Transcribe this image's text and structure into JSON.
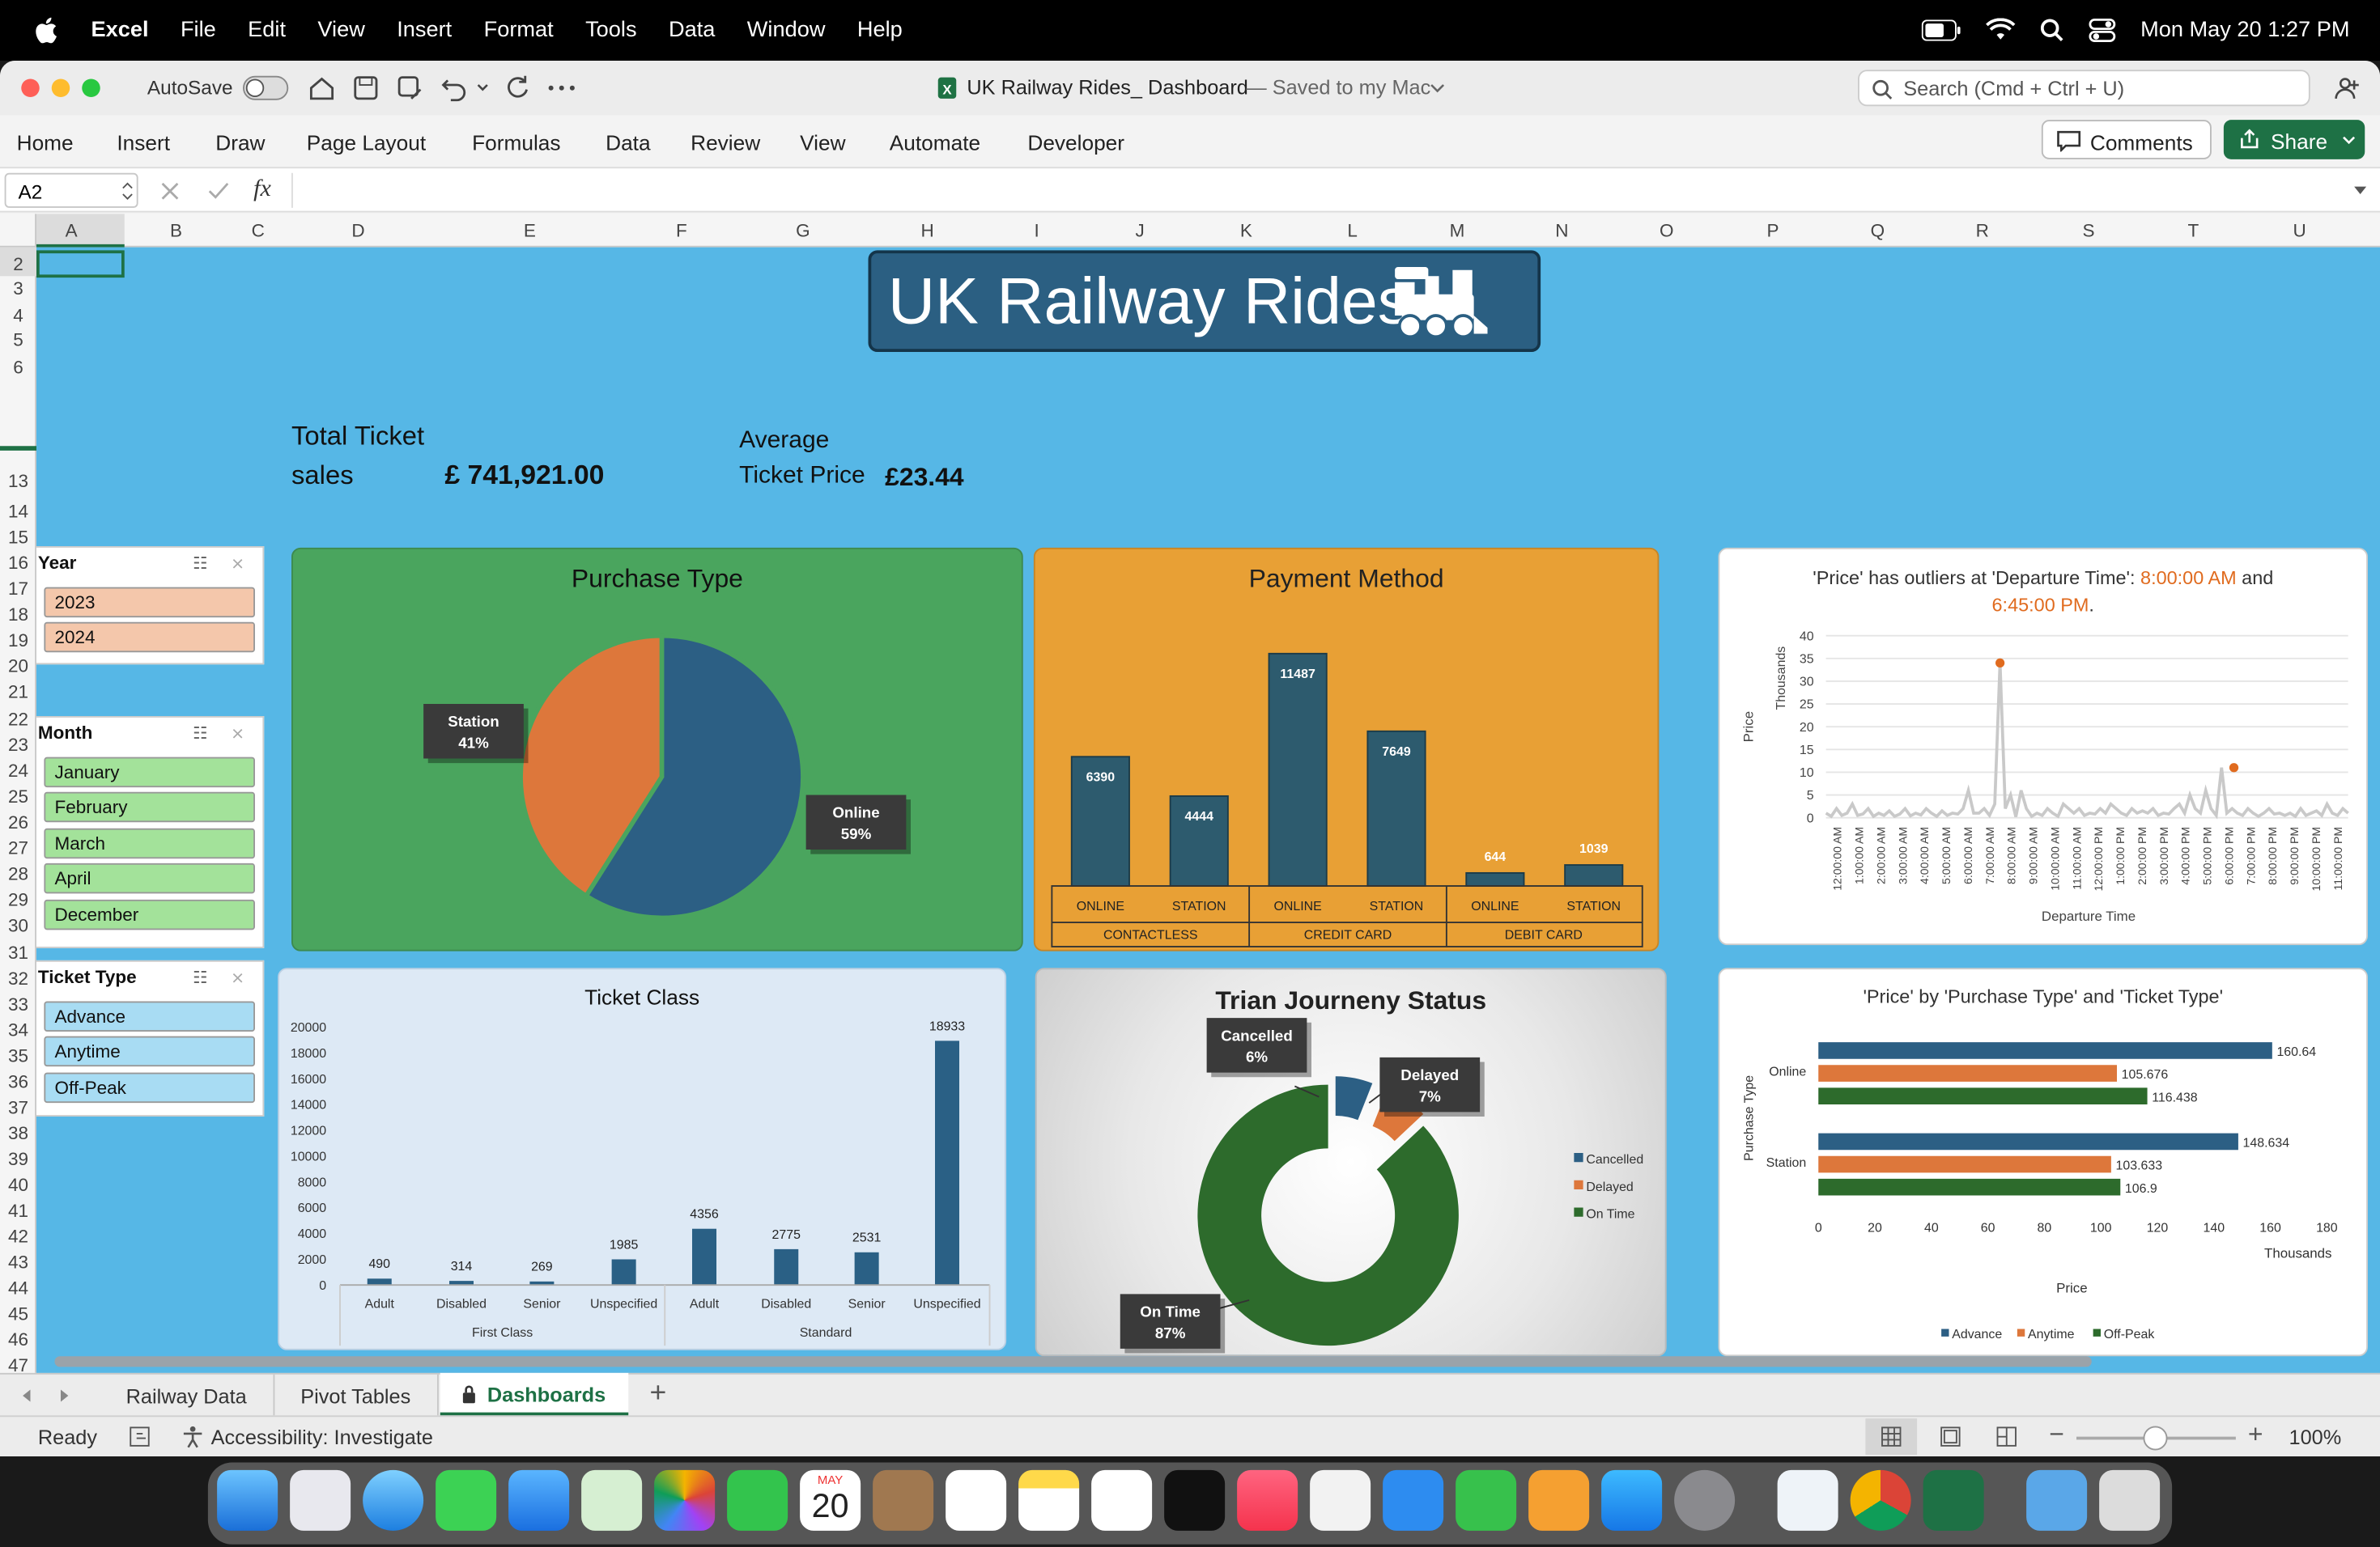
{
  "menubar": {
    "app": "Excel",
    "items": [
      "File",
      "Edit",
      "View",
      "Insert",
      "Format",
      "Tools",
      "Data",
      "Window",
      "Help"
    ],
    "datetime": "Mon May 20  1:27 PM"
  },
  "titlebar": {
    "autosave": "AutoSave",
    "title": "UK Railway Rides_ Dashboard",
    "saved": "— Saved to my Mac",
    "search_placeholder": "Search (Cmd + Ctrl + U)"
  },
  "ribbon": {
    "tabs": [
      "Home",
      "Insert",
      "Draw",
      "Page Layout",
      "Formulas",
      "Data",
      "Review",
      "View",
      "Automate",
      "Developer"
    ],
    "comments": "Comments",
    "share": "Share"
  },
  "formula_bar": {
    "name_box": "A2",
    "fx": "fx",
    "value": ""
  },
  "columns": [
    "A",
    "B",
    "C",
    "D",
    "E",
    "F",
    "G",
    "H",
    "I",
    "J",
    "K",
    "L",
    "M",
    "N",
    "O",
    "P",
    "Q",
    "R",
    "S",
    "T",
    "U"
  ],
  "rows": [
    "2",
    "3",
    "4",
    "5",
    "6",
    "13",
    "14",
    "15",
    "16",
    "17",
    "18",
    "19",
    "20",
    "21",
    "22",
    "23",
    "24",
    "25",
    "26",
    "27",
    "28",
    "29",
    "30",
    "31",
    "32",
    "33",
    "34",
    "35",
    "36",
    "37",
    "38",
    "39",
    "40",
    "41",
    "42",
    "43",
    "44",
    "45",
    "46",
    "47"
  ],
  "dashboard": {
    "title": "UK Railway Rides",
    "total_label_1": "Total Ticket",
    "total_label_2": "sales",
    "total_value": "£ 741,921.00",
    "avg_label_1": "Average",
    "avg_label_2": "Ticket Price",
    "avg_value": "£23.44"
  },
  "slicers": {
    "year": {
      "title": "Year",
      "items": [
        "2023",
        "2024"
      ],
      "color": "#f4c7ab"
    },
    "month": {
      "title": "Month",
      "items": [
        "January",
        "February",
        "March",
        "April",
        "December"
      ],
      "color": "#a3e29a"
    },
    "ticket_type": {
      "title": "Ticket Type",
      "items": [
        "Advance",
        "Anytime",
        "Off-Peak"
      ],
      "color": "#a8dcf3"
    }
  },
  "chart_data": [
    {
      "id": "purchase_type",
      "type": "pie",
      "title": "Purchase Type",
      "slices": [
        {
          "label": "Online",
          "value": 59,
          "display": "59%",
          "color": "#2c5f84"
        },
        {
          "label": "Station",
          "value": 41,
          "display": "41%",
          "color": "#dd773b"
        }
      ]
    },
    {
      "id": "payment_method",
      "type": "bar",
      "title": "Payment Method",
      "categories": [
        "ONLINE",
        "STATION",
        "ONLINE",
        "STATION",
        "ONLINE",
        "STATION"
      ],
      "groups": [
        "CONTACTLESS",
        "CREDIT CARD",
        "DEBIT CARD"
      ],
      "values": [
        6390,
        4444,
        11487,
        7649,
        644,
        1039
      ]
    },
    {
      "id": "price_outliers",
      "type": "line",
      "title_prefix": "'Price' has outliers at 'Departure Time':",
      "title_hl1": "8:00:00 AM",
      "title_and": "and",
      "title_hl2": "6:45:00 PM",
      "title_end": ".",
      "xlabel": "Departure Time",
      "ylabel": "Price",
      "yunits": "Thousands",
      "ylim": [
        0,
        40
      ],
      "yticks": [
        "0",
        "5",
        "10",
        "15",
        "20",
        "25",
        "30",
        "35",
        "40"
      ],
      "xticks": [
        "12:00:00 AM",
        "1:00:00 AM",
        "2:00:00 AM",
        "3:00:00 AM",
        "4:00:00 AM",
        "5:00:00 AM",
        "6:00:00 AM",
        "7:00:00 AM",
        "8:00:00 AM",
        "9:00:00 AM",
        "10:00:00 AM",
        "11:00:00 AM",
        "12:00:00 PM",
        "1:00:00 PM",
        "2:00:00 PM",
        "3:00:00 PM",
        "4:00:00 PM",
        "5:00:00 PM",
        "6:00:00 PM",
        "7:00:00 PM",
        "8:00:00 PM",
        "9:00:00 PM",
        "10:00:00 PM",
        "11:00:00 PM"
      ],
      "values": [
        1,
        0.3,
        2,
        0.5,
        1,
        3,
        0.5,
        0.8,
        2,
        0.3,
        1,
        0.5,
        1.5,
        0.3,
        0.8,
        2,
        0.4,
        1,
        0.6,
        2,
        1,
        0.3,
        1.5,
        0.5,
        1,
        0.8,
        2,
        6,
        1,
        1,
        2,
        0.5,
        3,
        2,
        2,
        5,
        0.2,
        6,
        2,
        0.3,
        1,
        0.5,
        2,
        1,
        0.3,
        3,
        2,
        1,
        2,
        0.5,
        1,
        0.8,
        2,
        1,
        3,
        2,
        1,
        0.5,
        2,
        1,
        1.5,
        1,
        2,
        0.5,
        1,
        0.8,
        2,
        3,
        1,
        5,
        2,
        1,
        6,
        2,
        0.5,
        11,
        1,
        2,
        1,
        0.5,
        2,
        1,
        0.3,
        1,
        2,
        0.8,
        1,
        0.5,
        1,
        0.3,
        2,
        0.5,
        1,
        1.5,
        0.5,
        3,
        1,
        0.5,
        2,
        1
      ],
      "outliers": [
        {
          "x": "8:00:00 AM",
          "value": 34
        },
        {
          "x": "6:45:00 PM",
          "value": 11
        }
      ]
    },
    {
      "id": "ticket_class",
      "type": "bar",
      "title": "Ticket Class",
      "categories": [
        "Adult",
        "Disabled",
        "Senior",
        "Unspecified",
        "Adult",
        "Disabled",
        "Senior",
        "Unspecified"
      ],
      "groups": [
        "First Class",
        "Standard"
      ],
      "values": [
        490,
        314,
        269,
        1985,
        4356,
        2775,
        2531,
        18933
      ],
      "ylim": [
        0,
        20000
      ],
      "yticks": [
        "0",
        "2000",
        "4000",
        "6000",
        "8000",
        "10000",
        "12000",
        "14000",
        "16000",
        "18000",
        "20000"
      ]
    },
    {
      "id": "journey_status",
      "type": "pie",
      "title": "Trian Journeny Status",
      "slices": [
        {
          "label": "Cancelled",
          "value": 6,
          "display": "6%",
          "color": "#2c5f84"
        },
        {
          "label": "Delayed",
          "value": 7,
          "display": "7%",
          "color": "#dd773b"
        },
        {
          "label": "On Time",
          "value": 87,
          "display": "87%",
          "color": "#2d6b2c"
        }
      ]
    },
    {
      "id": "price_by_purchase",
      "type": "bar",
      "title": "'Price' by 'Purchase Type' and 'Ticket Type'",
      "xlabel": "Price",
      "xunits": "Thousands",
      "ylabel": "Purchase Type",
      "categories": [
        "Online",
        "Station"
      ],
      "xlim": [
        0,
        180
      ],
      "xticks": [
        "0",
        "20",
        "40",
        "60",
        "80",
        "100",
        "120",
        "140",
        "160",
        "180"
      ],
      "series": [
        {
          "name": "Advance",
          "values": [
            160.64,
            148.634
          ],
          "color": "#2c5f84"
        },
        {
          "name": "Anytime",
          "values": [
            105.676,
            103.633
          ],
          "color": "#dd773b"
        },
        {
          "name": "Off-Peak",
          "values": [
            116.438,
            106.9
          ],
          "color": "#2d6b2c"
        }
      ]
    }
  ],
  "sheet_tabs": [
    "Railway Data",
    "Pivot Tables",
    "Dashboards"
  ],
  "status": {
    "ready": "Ready",
    "accessibility": "Accessibility: Investigate",
    "zoom": "100%"
  },
  "dock": {
    "calendar_month": "MAY",
    "calendar_day": "20"
  }
}
